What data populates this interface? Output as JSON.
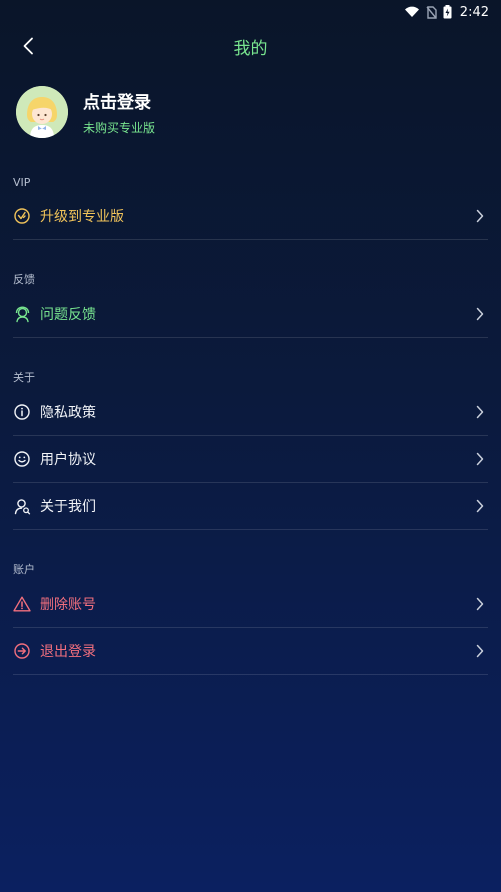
{
  "status_bar": {
    "time": "2:42"
  },
  "header": {
    "title": "我的"
  },
  "profile": {
    "login_text": "点击登录",
    "pro_status": "未购买专业版"
  },
  "sections": {
    "vip": {
      "label": "VIP",
      "upgrade": "升级到专业版"
    },
    "feedback": {
      "label": "反馈",
      "issue_feedback": "问题反馈"
    },
    "about": {
      "label": "关于",
      "privacy": "隐私政策",
      "agreement": "用户协议",
      "about_us": "关于我们"
    },
    "account": {
      "label": "账户",
      "delete_account": "删除账号",
      "logout": "退出登录"
    }
  },
  "colors": {
    "accent_green": "#78e58f",
    "vip_gold": "#f0c35a",
    "danger_red": "#f26f7e"
  }
}
